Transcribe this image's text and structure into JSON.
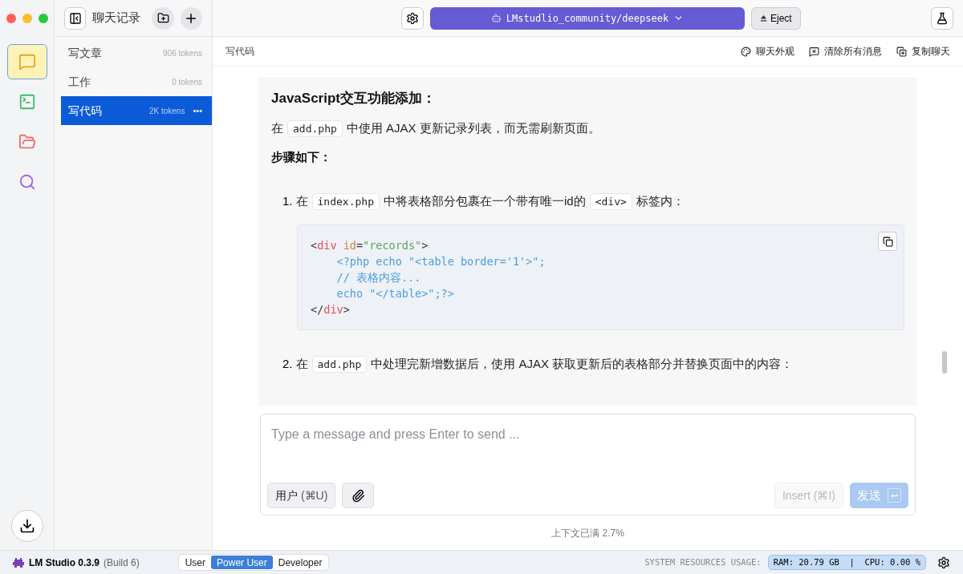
{
  "window": {
    "title": "聊天记录"
  },
  "rail": [
    {
      "kind": "chat",
      "selected": true
    },
    {
      "kind": "terminal",
      "selected": false
    },
    {
      "kind": "folder",
      "selected": false
    },
    {
      "kind": "search",
      "selected": false
    }
  ],
  "chats": [
    {
      "name": "写文章",
      "tokens": "906 tokens",
      "selected": false
    },
    {
      "name": "工作",
      "tokens": "0 tokens",
      "selected": false
    },
    {
      "name": "写代码",
      "tokens": "2K tokens",
      "selected": true,
      "more": "•••"
    }
  ],
  "model": {
    "name": "LMstudlio_community/deepseek",
    "eject": "Eject"
  },
  "chat_title": "写代码",
  "actions": [
    {
      "kind": "palette",
      "label": "聊天外观"
    },
    {
      "kind": "clear",
      "label": "清除所有消息"
    },
    {
      "kind": "copy",
      "label": "复制聊天"
    }
  ],
  "message": {
    "heading": "JavaScript交互功能添加：",
    "intro": [
      {
        "kind": "text",
        "text": "在"
      },
      {
        "kind": "code",
        "text": "add.php"
      },
      {
        "kind": "text",
        "text": "中使用 AJAX 更新记录列表，而无需刷新页面。"
      }
    ],
    "subheading": "步骤如下：",
    "steps": [
      {
        "number": "1.",
        "parts": [
          {
            "kind": "text",
            "text": "在"
          },
          {
            "kind": "code",
            "text": "index.php"
          },
          {
            "kind": "text",
            "text": "中将表格部分包裹在一个带有唯一id的"
          },
          {
            "kind": "code",
            "text": "<div>"
          },
          {
            "kind": "text",
            "text": "标签内："
          }
        ],
        "code": [
          {
            "tokens": [
              {
                "kind": "punct",
                "text": "<"
              },
              {
                "kind": "tag",
                "text": "div"
              },
              {
                "kind": "attr",
                "text": " id"
              },
              {
                "kind": "punct",
                "text": "="
              },
              {
                "kind": "string",
                "text": "\"records\""
              },
              {
                "kind": "punct",
                "text": ">"
              }
            ]
          },
          {
            "tokens": [
              {
                "kind": "php",
                "text": "    <?php echo \"<table border='1'>\";"
              }
            ]
          },
          {
            "tokens": [
              {
                "kind": "php",
                "text": "    // 表格内容..."
              }
            ]
          },
          {
            "tokens": [
              {
                "kind": "php",
                "text": "    echo \"</table>\";?>"
              }
            ]
          },
          {
            "tokens": [
              {
                "kind": "punct",
                "text": "</"
              },
              {
                "kind": "tag",
                "text": "div"
              },
              {
                "kind": "punct",
                "text": ">"
              }
            ]
          }
        ]
      },
      {
        "number": "2.",
        "parts": [
          {
            "kind": "text",
            "text": "在"
          },
          {
            "kind": "code",
            "text": "add.php"
          },
          {
            "kind": "text",
            "text": "中处理完新增数据后，使用 AJAX 获取更新后的表格部分并替换页面中的内容："
          }
        ]
      }
    ]
  },
  "composer": {
    "placeholder": "Type a message and press Enter to send ...",
    "role": "用户",
    "role_shortcut": "(⌘U)",
    "insert": "Insert (⌘I)",
    "send": "发送",
    "send_key": "↩",
    "context": "上下文已满 2.7%"
  },
  "status_bar": {
    "app": "LM Studio 0.3.9",
    "build": "(Build 6)",
    "modes": [
      {
        "label": "User",
        "selected": false
      },
      {
        "label": "Power User",
        "selected": true
      },
      {
        "label": "Developer",
        "selected": false
      }
    ],
    "usage_label": "SYSTEM RESOURCES USAGE:",
    "usage": "RAM: 20.79 GB  |  CPU: 0.00 %"
  }
}
